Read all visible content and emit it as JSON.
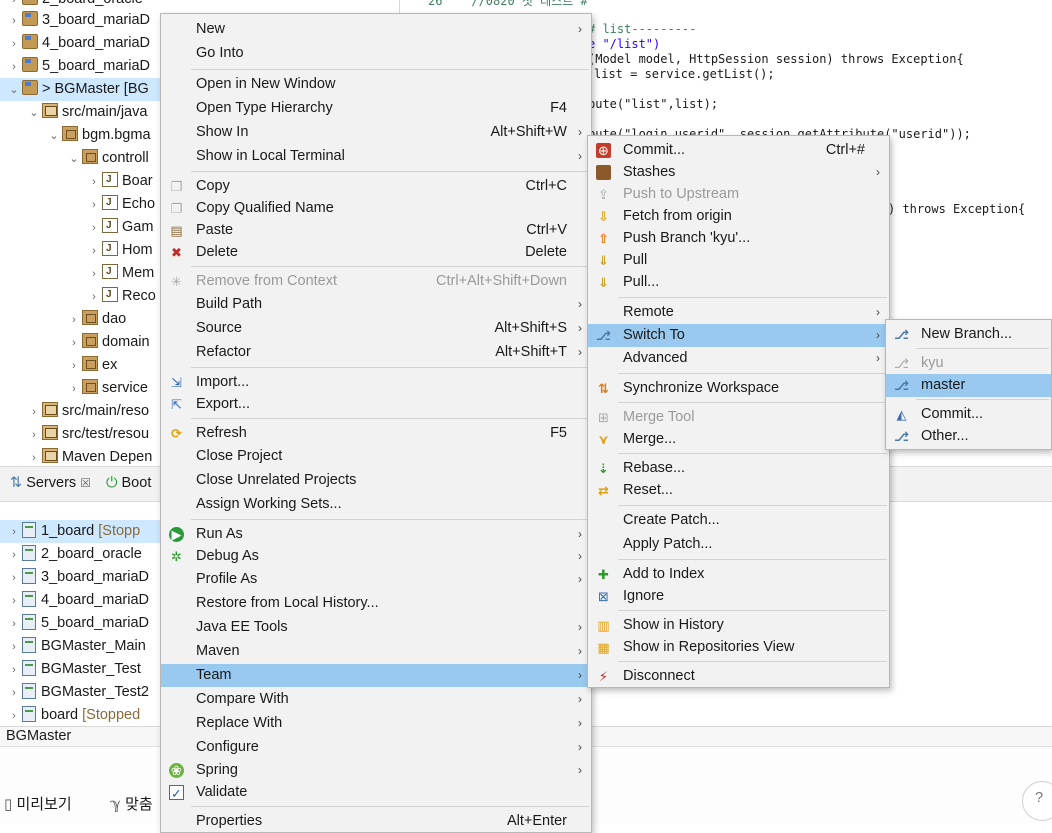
{
  "explorer": {
    "rows": [
      {
        "label": "2_board_oracle"
      },
      {
        "label": "3_board_mariaD"
      },
      {
        "label": "4_board_mariaD"
      },
      {
        "label": "5_board_mariaD"
      },
      {
        "label": "> BGMaster [BG"
      },
      {
        "label": "src/main/java"
      },
      {
        "label": "bgm.bgma"
      },
      {
        "label": "controll"
      },
      {
        "label": "Boar"
      },
      {
        "label": "Echo"
      },
      {
        "label": "Gam"
      },
      {
        "label": "Hom"
      },
      {
        "label": "Mem"
      },
      {
        "label": "Reco"
      },
      {
        "label": "dao"
      },
      {
        "label": "domain"
      },
      {
        "label": "ex"
      },
      {
        "label": "service"
      },
      {
        "label": "src/main/reso"
      },
      {
        "label": "src/test/resou"
      },
      {
        "label": "Maven Depen"
      }
    ]
  },
  "editor": {
    "lines": [
      {
        "text": "26    //0820 첫 테스트 #"
      },
      {
        "text": "# list---------"
      },
      {
        "text": "e \"/list\")"
      },
      {
        "text": "(Model model, HttpSession session) throws Exception{"
      },
      {
        "text": "list = service.getList();"
      },
      {
        "text": "bute(\"list\",list);"
      },
      {
        "text": "bute(\"login_userid\", session.getAttribute(\"userid\"));"
      },
      {
        "text": ") throws Exception{"
      }
    ]
  },
  "panel": {
    "tabs": [
      {
        "label": "Servers",
        "close": "☒"
      },
      {
        "label": "Boot"
      }
    ]
  },
  "servers": {
    "rows": [
      {
        "name": "1_board",
        "state": "[Stopp"
      },
      {
        "name": "2_board_oracle",
        "state": ""
      },
      {
        "name": "3_board_mariaD",
        "state": ""
      },
      {
        "name": "4_board_mariaD",
        "state": ""
      },
      {
        "name": "5_board_mariaD",
        "state": ""
      },
      {
        "name": "BGMaster_Main",
        "state": ""
      },
      {
        "name": "BGMaster_Test",
        "state": ""
      },
      {
        "name": "BGMaster_Test2",
        "state": ""
      },
      {
        "name": "board",
        "state": "[Stopped"
      }
    ]
  },
  "status": {
    "text": "BGMaster"
  },
  "taskbar": {
    "preview": "미리보기",
    "spell": "맞춤"
  },
  "context_menu": {
    "groups": [
      [
        {
          "label": "New",
          "accel": "",
          "submenu": true
        },
        {
          "label": "Go Into",
          "accel": "",
          "submenu": false
        }
      ],
      [
        {
          "label": "Open in New Window",
          "accel": "",
          "submenu": false
        },
        {
          "label": "Open Type Hierarchy",
          "accel": "F4",
          "submenu": false
        },
        {
          "label": "Show In",
          "accel": "Alt+Shift+W",
          "submenu": true
        },
        {
          "label": "Show in Local Terminal",
          "accel": "",
          "submenu": true
        }
      ],
      [
        {
          "label": "Copy",
          "accel": "Ctrl+C",
          "submenu": false,
          "icon": "copy-icon"
        },
        {
          "label": "Copy Qualified Name",
          "accel": "",
          "submenu": false,
          "icon": "copy-qualified-icon"
        },
        {
          "label": "Paste",
          "accel": "Ctrl+V",
          "submenu": false,
          "icon": "paste-icon"
        },
        {
          "label": "Delete",
          "accel": "Delete",
          "submenu": false,
          "icon": "delete-icon"
        }
      ],
      [
        {
          "label": "Remove from Context",
          "accel": "Ctrl+Alt+Shift+Down",
          "submenu": false,
          "disabled": true,
          "icon": "remove-context-icon"
        },
        {
          "label": "Build Path",
          "accel": "",
          "submenu": true
        },
        {
          "label": "Source",
          "accel": "Alt+Shift+S",
          "submenu": true
        },
        {
          "label": "Refactor",
          "accel": "Alt+Shift+T",
          "submenu": true
        }
      ],
      [
        {
          "label": "Import...",
          "accel": "",
          "submenu": false,
          "icon": "import-icon"
        },
        {
          "label": "Export...",
          "accel": "",
          "submenu": false,
          "icon": "export-icon"
        }
      ],
      [
        {
          "label": "Refresh",
          "accel": "F5",
          "submenu": false,
          "icon": "refresh-icon"
        },
        {
          "label": "Close Project",
          "accel": "",
          "submenu": false
        },
        {
          "label": "Close Unrelated Projects",
          "accel": "",
          "submenu": false
        },
        {
          "label": "Assign Working Sets...",
          "accel": "",
          "submenu": false
        }
      ],
      [
        {
          "label": "Run As",
          "accel": "",
          "submenu": true,
          "icon": "run-icon"
        },
        {
          "label": "Debug As",
          "accel": "",
          "submenu": true,
          "icon": "debug-icon"
        },
        {
          "label": "Profile As",
          "accel": "",
          "submenu": true
        },
        {
          "label": "Restore from Local History...",
          "accel": "",
          "submenu": false
        },
        {
          "label": "Java EE Tools",
          "accel": "",
          "submenu": true
        },
        {
          "label": "Maven",
          "accel": "",
          "submenu": true
        },
        {
          "label": "Team",
          "accel": "",
          "submenu": true,
          "highlighted": true
        },
        {
          "label": "Compare With",
          "accel": "",
          "submenu": true
        },
        {
          "label": "Replace With",
          "accel": "",
          "submenu": true
        },
        {
          "label": "Configure",
          "accel": "",
          "submenu": true
        },
        {
          "label": "Spring",
          "accel": "",
          "submenu": true,
          "icon": "spring-icon"
        },
        {
          "label": "Validate",
          "accel": "",
          "submenu": false,
          "icon": "validate-check-icon"
        }
      ],
      [
        {
          "label": "Properties",
          "accel": "Alt+Enter",
          "submenu": false
        }
      ]
    ]
  },
  "team_menu": {
    "groups": [
      [
        {
          "label": "Commit...",
          "accel": "Ctrl+#",
          "submenu": false,
          "icon": "commit-icon"
        },
        {
          "label": "Stashes",
          "accel": "",
          "submenu": true,
          "icon": "stash-icon"
        },
        {
          "label": "Push to Upstream",
          "accel": "",
          "submenu": false,
          "disabled": true,
          "icon": "push-upstream-icon"
        },
        {
          "label": "Fetch from origin",
          "accel": "",
          "submenu": false,
          "icon": "fetch-icon"
        },
        {
          "label": "Push Branch 'kyu'...",
          "accel": "",
          "submenu": false,
          "icon": "push-branch-icon"
        },
        {
          "label": "Pull",
          "accel": "",
          "submenu": false,
          "icon": "pull-icon"
        },
        {
          "label": "Pull...",
          "accel": "",
          "submenu": false,
          "icon": "pull-dialog-icon"
        }
      ],
      [
        {
          "label": "Remote",
          "accel": "",
          "submenu": true
        },
        {
          "label": "Switch To",
          "accel": "",
          "submenu": true,
          "highlighted": true,
          "icon": "switch-branch-icon"
        },
        {
          "label": "Advanced",
          "accel": "",
          "submenu": true
        }
      ],
      [
        {
          "label": "Synchronize Workspace",
          "accel": "",
          "submenu": false,
          "icon": "synchronize-icon"
        }
      ],
      [
        {
          "label": "Merge Tool",
          "accel": "",
          "submenu": false,
          "disabled": true,
          "icon": "merge-tool-icon"
        },
        {
          "label": "Merge...",
          "accel": "",
          "submenu": false,
          "icon": "merge-icon"
        }
      ],
      [
        {
          "label": "Rebase...",
          "accel": "",
          "submenu": false,
          "icon": "rebase-icon"
        },
        {
          "label": "Reset...",
          "accel": "",
          "submenu": false,
          "icon": "reset-icon"
        }
      ],
      [
        {
          "label": "Create Patch...",
          "accel": "",
          "submenu": false
        },
        {
          "label": "Apply Patch...",
          "accel": "",
          "submenu": false
        }
      ],
      [
        {
          "label": "Add to Index",
          "accel": "",
          "submenu": false,
          "icon": "add-index-icon"
        },
        {
          "label": "Ignore",
          "accel": "",
          "submenu": false,
          "icon": "ignore-icon"
        }
      ],
      [
        {
          "label": "Show in History",
          "accel": "",
          "submenu": false,
          "icon": "history-icon"
        },
        {
          "label": "Show in Repositories View",
          "accel": "",
          "submenu": false,
          "icon": "repositories-icon"
        }
      ],
      [
        {
          "label": "Disconnect",
          "accel": "",
          "submenu": false,
          "icon": "disconnect-icon"
        }
      ]
    ]
  },
  "switch_menu": {
    "groups": [
      [
        {
          "label": "New Branch...",
          "icon": "new-branch-icon"
        }
      ],
      [
        {
          "label": "kyu",
          "disabled": true,
          "icon": "branch-kyu-icon"
        },
        {
          "label": "master",
          "highlighted": true,
          "icon": "branch-master-icon"
        }
      ],
      [
        {
          "label": "Commit...",
          "icon": "commit-switch-icon"
        },
        {
          "label": "Other...",
          "icon": "other-branch-icon"
        }
      ]
    ]
  },
  "colors": {
    "highlight": "#99c9ef",
    "menu_bg": "#f2f2f2",
    "selection": "#cde8ff"
  }
}
